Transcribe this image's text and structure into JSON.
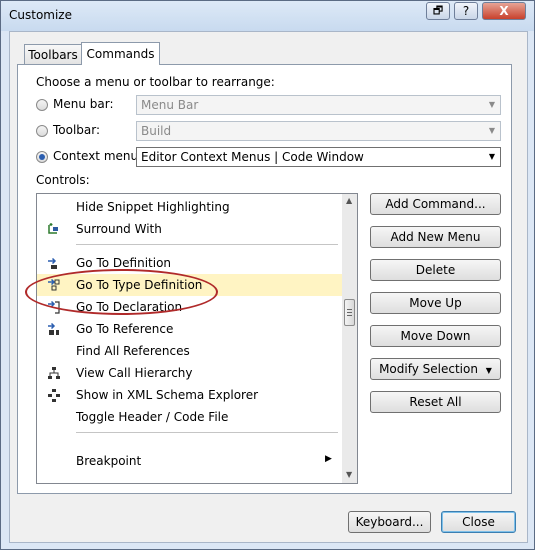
{
  "window": {
    "title": "Customize",
    "restore_glyph": "🗗",
    "help_glyph": "?",
    "close_glyph": "X"
  },
  "tabs": [
    "Toolbars",
    "Commands"
  ],
  "rearrange": {
    "label": "Choose a menu or toolbar to rearrange:",
    "menu_bar": {
      "label": "Menu bar:",
      "value": "Menu Bar",
      "enabled": false,
      "selected": false
    },
    "toolbar": {
      "label": "Toolbar:",
      "value": "Build",
      "enabled": false,
      "selected": false
    },
    "context_menu": {
      "label": "Context menu:",
      "value": "Editor Context Menus | Code Window",
      "enabled": true,
      "selected": true
    }
  },
  "controls": {
    "label": "Controls:",
    "items": [
      {
        "text": "Hide Snippet Highlighting",
        "icon": ""
      },
      {
        "text": "Surround With",
        "icon": "surround-icon"
      },
      {
        "text": "Go To Definition",
        "icon": "goto-definition-icon"
      },
      {
        "text": "Go To Type Definition",
        "icon": "goto-type-definition-icon",
        "selected": true
      },
      {
        "text": "Go To Declaration",
        "icon": "goto-declaration-icon"
      },
      {
        "text": "Go To Reference",
        "icon": "goto-reference-icon"
      },
      {
        "text": "Find All References",
        "icon": ""
      },
      {
        "text": "View Call Hierarchy",
        "icon": "call-hierarchy-icon"
      },
      {
        "text": "Show in XML Schema Explorer",
        "icon": "xml-schema-icon"
      },
      {
        "text": "Toggle Header / Code File",
        "icon": ""
      },
      {
        "text": "Breakpoint",
        "icon": "",
        "submenu": true
      }
    ]
  },
  "buttons": {
    "add_command": "Add Command...",
    "add_new_menu": "Add New Menu",
    "delete": "Delete",
    "move_up": "Move Up",
    "move_down": "Move Down",
    "modify_selection": "Modify Selection",
    "reset_all": "Reset All",
    "keyboard": "Keyboard...",
    "close": "Close"
  },
  "colors": {
    "selection": "#fff4c3",
    "highlight_ring": "#b02a2a",
    "accent": "#2c5fb0"
  }
}
